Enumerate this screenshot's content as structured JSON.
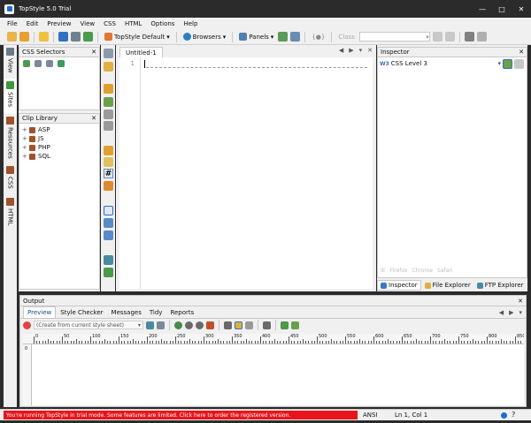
{
  "window": {
    "title": "TopStyle 5.0 Trial"
  },
  "menu": [
    "File",
    "Edit",
    "Preview",
    "View",
    "CSS",
    "HTML",
    "Options",
    "Help"
  ],
  "toolbar": {
    "style_label": "TopStyle Default",
    "browsers_label": "Browsers",
    "panels_label": "Panels",
    "class_placeholder": "Class"
  },
  "left_tabs": [
    "View",
    "Sites",
    "Resources",
    "CSS",
    "HTML"
  ],
  "css_selectors": {
    "title": "CSS Selectors"
  },
  "clip_library": {
    "title": "Clip Library",
    "items": [
      "ASP",
      "JS",
      "PHP",
      "SQL"
    ]
  },
  "editor": {
    "tab_label": "Untitled-1",
    "line_number": "1"
  },
  "inspector": {
    "title": "Inspector",
    "level": "CSS Level 3",
    "browsers": [
      "IE",
      "Firefox",
      "Chrome",
      "Safari"
    ],
    "bottom_tabs": [
      "Inspector",
      "File Explorer",
      "FTP Explorer"
    ]
  },
  "output": {
    "title": "Output",
    "tabs": [
      "Preview",
      "Style Checker",
      "Messages",
      "Tidy",
      "Reports"
    ],
    "source_placeholder": "(Create from current style sheet)",
    "ruler_labels": [
      "0",
      "50",
      "100",
      "150",
      "200",
      "250",
      "300",
      "350",
      "400",
      "450",
      "500",
      "550",
      "600",
      "650",
      "700",
      "750",
      "800",
      "850"
    ]
  },
  "status": {
    "trial_message": "You're running TopStyle in trial mode. Some features are limited. Click here to order the registered version.",
    "encoding": "ANSI",
    "position": "Ln 1, Col 1"
  },
  "colors": {
    "trial_bar": "#e8141c",
    "title_bg": "#2b2b2b",
    "accent": "#1e6bd6"
  }
}
